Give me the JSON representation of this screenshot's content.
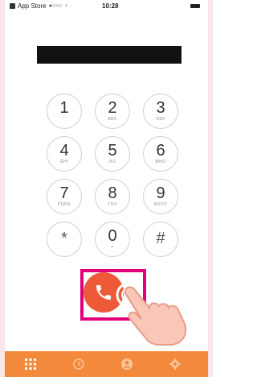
{
  "status_bar": {
    "carrier": "App Store",
    "signal": "●○○○○",
    "time": "10:28"
  },
  "number_display": {
    "value": ""
  },
  "keypad": {
    "keys": [
      {
        "digit": "1",
        "letters": ""
      },
      {
        "digit": "2",
        "letters": "ABC"
      },
      {
        "digit": "3",
        "letters": "DEF"
      },
      {
        "digit": "4",
        "letters": "GHI"
      },
      {
        "digit": "5",
        "letters": "JKL"
      },
      {
        "digit": "6",
        "letters": "MNO"
      },
      {
        "digit": "7",
        "letters": "PQRS"
      },
      {
        "digit": "8",
        "letters": "TUV"
      },
      {
        "digit": "9",
        "letters": "WXYZ"
      },
      {
        "digit": "*",
        "letters": ""
      },
      {
        "digit": "0",
        "letters": "+"
      },
      {
        "digit": "#",
        "letters": ""
      }
    ]
  },
  "tab_bar": {
    "tabs": [
      {
        "icon": "keypad-grid-icon",
        "active": true
      },
      {
        "icon": "history-clock-icon",
        "active": false
      },
      {
        "icon": "contact-person-icon",
        "active": false
      },
      {
        "icon": "settings-gear-icon",
        "active": false
      }
    ]
  },
  "colors": {
    "call_button": "#ee5a37",
    "highlight": "#e2007a",
    "tab_bar": "#f2893b",
    "background": "#fbe6e9"
  }
}
